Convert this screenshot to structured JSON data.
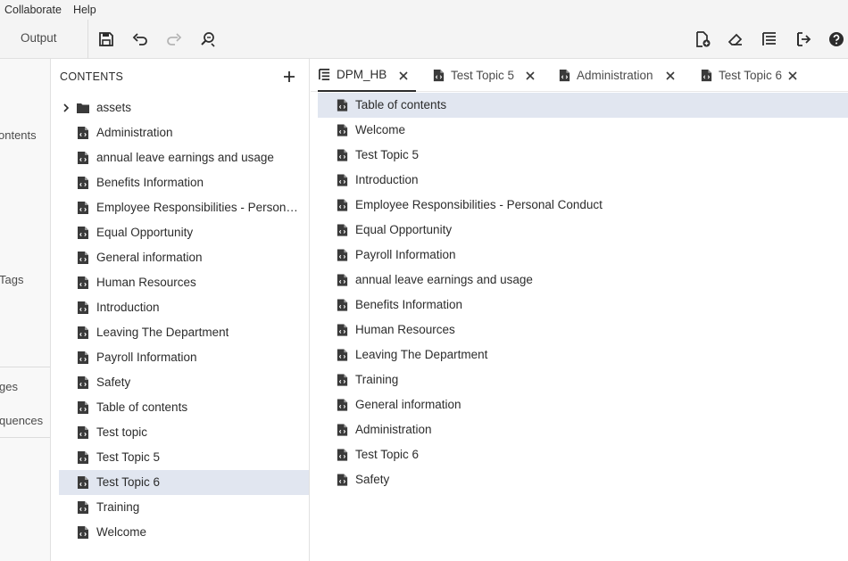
{
  "menubar": {
    "items": [
      "Collaborate",
      "Help"
    ]
  },
  "toolbar": {
    "output_label": "Output"
  },
  "leftnav": {
    "items": [
      "ontents",
      "Tags",
      "ges",
      "quences"
    ]
  },
  "contents": {
    "header": "CONTENTS",
    "tree": [
      {
        "label": "assets",
        "type": "folder"
      },
      {
        "label": "Administration",
        "type": "topic"
      },
      {
        "label": "annual leave earnings and usage",
        "type": "topic"
      },
      {
        "label": "Benefits Information",
        "type": "topic"
      },
      {
        "label": "Employee Responsibilities - Personal Conduct",
        "type": "topic"
      },
      {
        "label": "Equal Opportunity",
        "type": "topic"
      },
      {
        "label": "General information",
        "type": "topic"
      },
      {
        "label": "Human Resources",
        "type": "topic"
      },
      {
        "label": "Introduction",
        "type": "topic"
      },
      {
        "label": "Leaving The Department",
        "type": "topic"
      },
      {
        "label": "Payroll Information",
        "type": "topic"
      },
      {
        "label": "Safety",
        "type": "topic"
      },
      {
        "label": "Table of contents",
        "type": "topic"
      },
      {
        "label": "Test topic",
        "type": "topic"
      },
      {
        "label": "Test Topic 5",
        "type": "topic"
      },
      {
        "label": "Test Topic 6",
        "type": "topic",
        "selected": true
      },
      {
        "label": "Training",
        "type": "topic"
      },
      {
        "label": "Welcome",
        "type": "topic"
      }
    ]
  },
  "editor": {
    "tabs": [
      {
        "label": "DPM_HB",
        "type": "map",
        "active": true
      },
      {
        "label": "Test Topic 5",
        "type": "topic"
      },
      {
        "label": "Administration",
        "type": "topic"
      },
      {
        "label": "Test Topic 6",
        "type": "topic"
      }
    ],
    "map_items": [
      {
        "label": "Table of contents",
        "selected": true
      },
      {
        "label": "Welcome"
      },
      {
        "label": "Test Topic 5"
      },
      {
        "label": "Introduction"
      },
      {
        "label": "Employee Responsibilities - Personal Conduct"
      },
      {
        "label": "Equal Opportunity"
      },
      {
        "label": "Payroll Information"
      },
      {
        "label": "annual leave earnings and usage"
      },
      {
        "label": "Benefits Information"
      },
      {
        "label": "Human Resources"
      },
      {
        "label": "Leaving The Department"
      },
      {
        "label": "Training"
      },
      {
        "label": "General information"
      },
      {
        "label": "Administration"
      },
      {
        "label": "Test Topic 6"
      },
      {
        "label": "Safety"
      }
    ]
  }
}
